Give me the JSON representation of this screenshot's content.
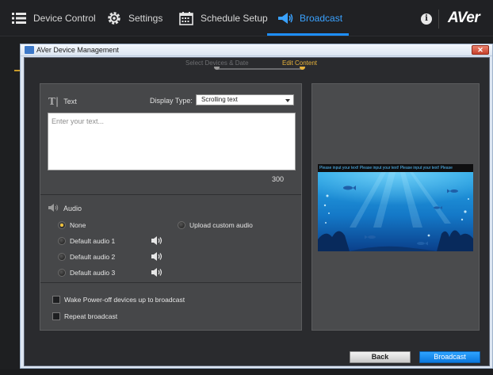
{
  "nav": {
    "items": [
      {
        "label": "Device Control",
        "icon": "list-icon"
      },
      {
        "label": "Settings",
        "icon": "gear-icon"
      },
      {
        "label": "Schedule Setup",
        "icon": "calendar-icon"
      },
      {
        "label": "Broadcast",
        "icon": "megaphone-icon"
      }
    ],
    "active": "Broadcast",
    "info_symbol": "i",
    "logo": "AVer"
  },
  "window": {
    "title": "AVer Device Management",
    "close_symbol": "✕"
  },
  "steps": {
    "step1": "Select Devices & Date",
    "step2": "Edit Content",
    "active_step": "Edit Content"
  },
  "text_section": {
    "label": "Text",
    "display_type_label": "Display Type:",
    "display_type_value": "Scrolling text",
    "placeholder": "Enter your text...",
    "char_count": "300"
  },
  "audio_section": {
    "label": "Audio",
    "options": {
      "none": "None",
      "upload": "Upload custom audio",
      "default1": "Default audio 1",
      "default2": "Default audio 2",
      "default3": "Default audio 3"
    },
    "selected": "None"
  },
  "options_section": {
    "wake": "Wake Power-off devices up to broadcast",
    "repeat": "Repeat broadcast"
  },
  "preview": {
    "ticker_text": "Please input your text!   Please input your text!   Please input your text!   Please"
  },
  "buttons": {
    "back": "Back",
    "broadcast": "Broadcast"
  },
  "colors": {
    "accent": "#1e8fff",
    "step_active": "#e7b33b",
    "panel": "#464749",
    "background": "#2a2b2e"
  }
}
